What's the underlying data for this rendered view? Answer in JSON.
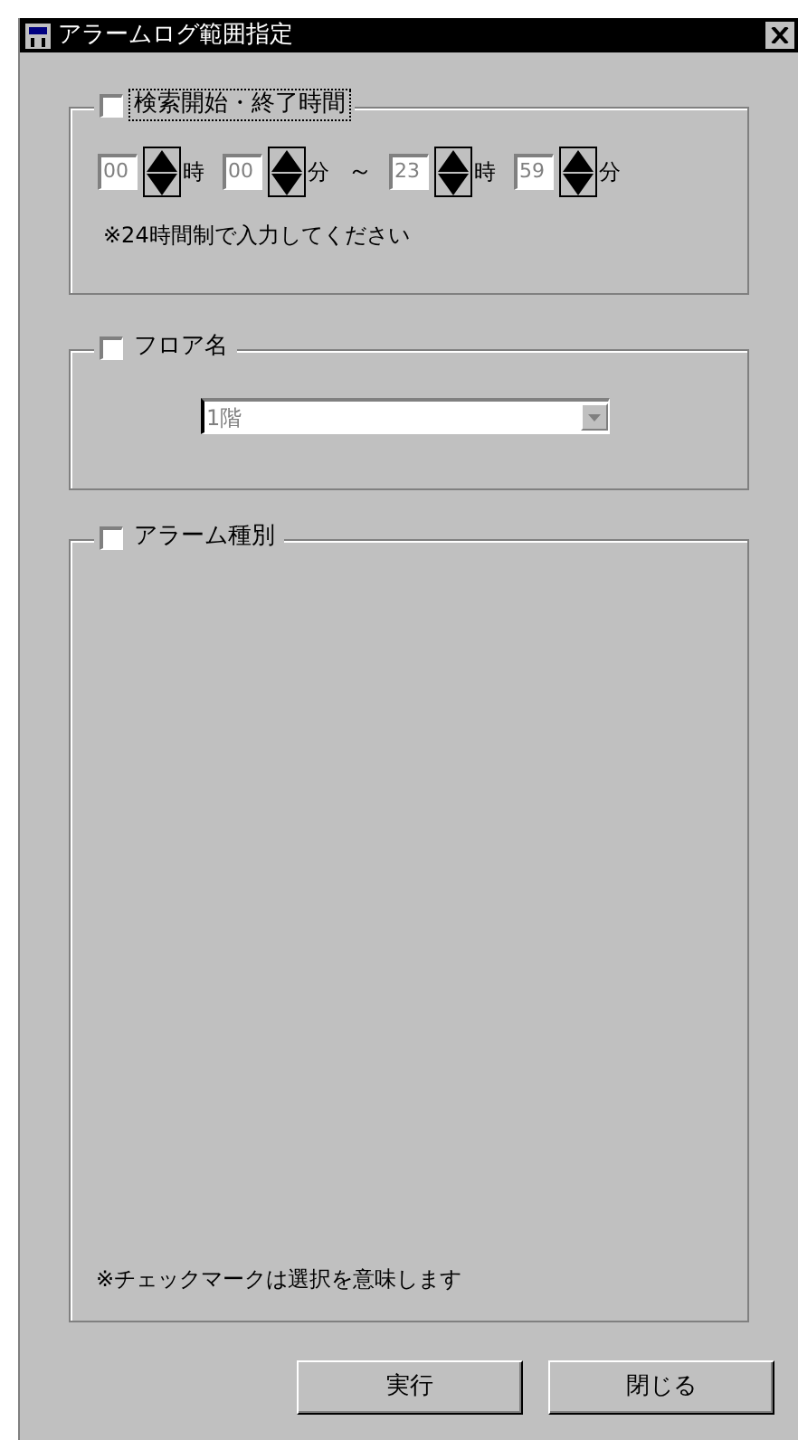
{
  "window": {
    "title": "アラームログ範囲指定"
  },
  "time_range": {
    "label": "検索開始・終了時間",
    "checked": false,
    "focused": true,
    "disabled": true,
    "fields": [
      {
        "value": "00",
        "unit": "時"
      },
      {
        "value": "00",
        "unit": "分"
      },
      {
        "value": "23",
        "unit": "時"
      },
      {
        "value": "59",
        "unit": "分"
      }
    ],
    "separator": "～",
    "note": "※24時間制で入力してください"
  },
  "floor": {
    "label": "フロア名",
    "checked": false,
    "focused": false,
    "select": {
      "value": "1階",
      "disabled": true
    }
  },
  "alarm_type": {
    "label": "アラーム種別",
    "checked": false,
    "focused": false,
    "note": "※チェックマークは選択を意味します"
  },
  "buttons": [
    "実行",
    "閉じる"
  ]
}
